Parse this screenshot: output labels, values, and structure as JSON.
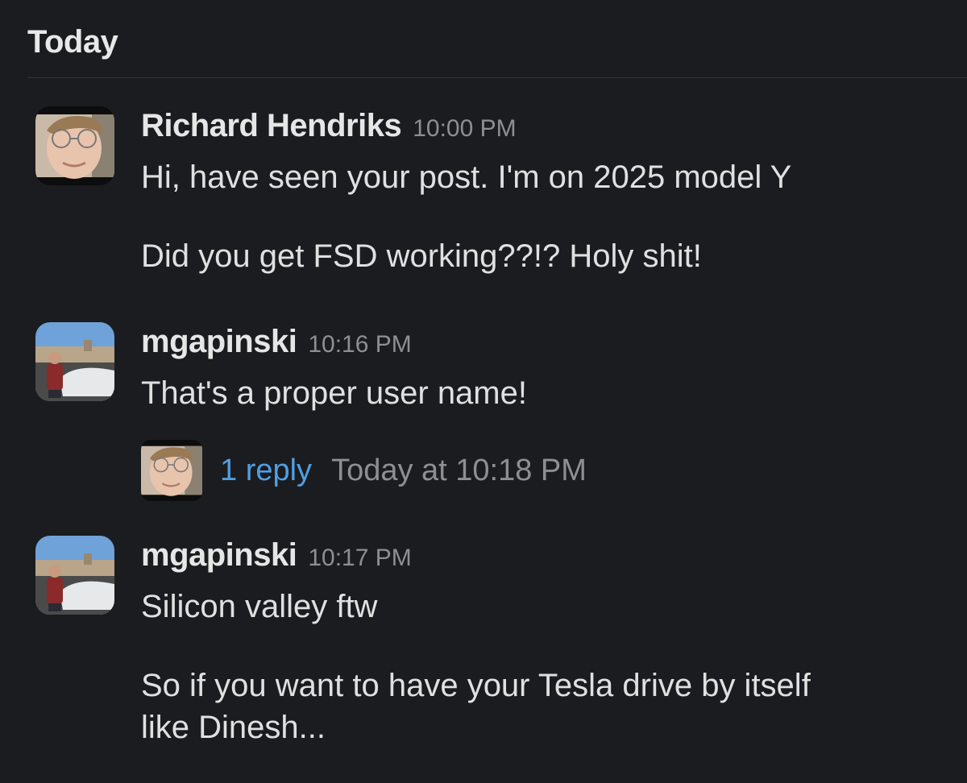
{
  "channel": {
    "date_divider": "Today"
  },
  "messages": [
    {
      "author": "Richard Hendriks",
      "time": "10:00 PM",
      "avatar": "person-with-glasses-avatar",
      "paragraphs": [
        "Hi, have seen your post. I'm on 2025 model Y",
        "Did you get FSD working??!? Holy shit!"
      ]
    },
    {
      "author": "mgapinski",
      "time": "10:16 PM",
      "avatar": "person-with-car-avatar",
      "paragraphs": [
        "That's a proper user name!"
      ],
      "thread": {
        "avatar": "person-with-glasses-avatar",
        "reply_label": "1 reply",
        "last_reply": "Today at 10:18 PM"
      }
    },
    {
      "author": "mgapinski",
      "time": "10:17 PM",
      "avatar": "person-with-car-avatar",
      "paragraphs": [
        "Silicon valley ftw",
        "So if you want to have your Tesla drive by itself\nlike Dinesh..."
      ]
    }
  ],
  "colors": {
    "background": "#1b1c1f",
    "link": "#4f9fe2",
    "muted": "#8e8f93",
    "text": "#e0e0e0"
  }
}
